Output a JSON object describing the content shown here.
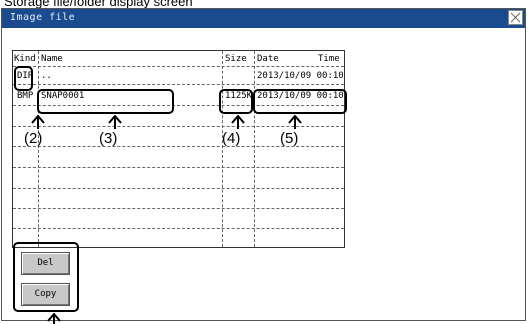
{
  "page": {
    "caption": "Storage file/folder display screen"
  },
  "window": {
    "title": "Image file",
    "close_icon": "close-icon"
  },
  "table": {
    "headers": {
      "kind": "Kind",
      "name": "Name",
      "size": "Size",
      "date": "Date",
      "time": "Time"
    },
    "rows": [
      {
        "kind": "DIR",
        "name": "..",
        "size": "",
        "date": "2013/10/09 00:10"
      },
      {
        "kind": "BMP",
        "name": "SNAP0001",
        "size": "1125K",
        "date": "2013/10/09 00:10"
      }
    ]
  },
  "annotations": {
    "kind": "(2)",
    "name": "(3)",
    "size": "(4)",
    "date": "(5)"
  },
  "buttons": {
    "del": "Del",
    "copy": "Copy"
  }
}
